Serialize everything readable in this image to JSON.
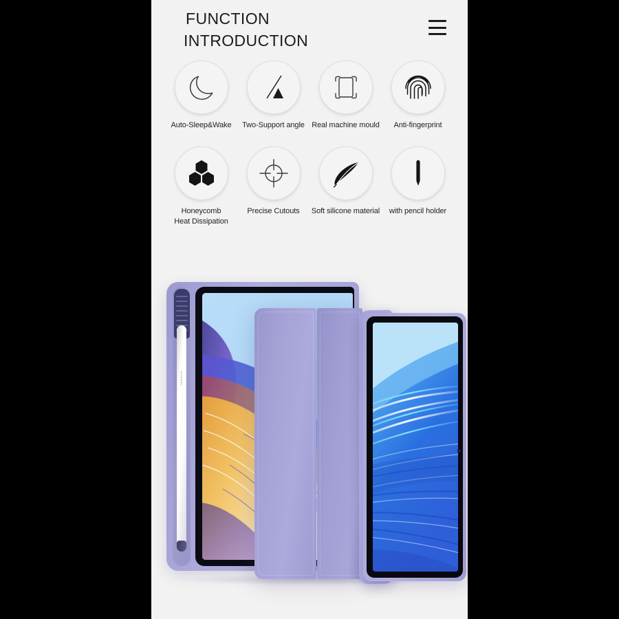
{
  "page": {
    "background_color": "#000000",
    "panel_color": "#f2f2f2"
  },
  "header": {
    "title_line1": "FUNCTION",
    "title_line2": "INTRODUCTION",
    "menu_icon": "hamburger-menu-icon"
  },
  "features": {
    "row1": [
      {
        "icon": "moon-icon",
        "label": "Auto-Sleep&Wake"
      },
      {
        "icon": "stand-angle-icon",
        "label": "Two-Support angle"
      },
      {
        "icon": "device-mould-icon",
        "label": "Real machine mould"
      },
      {
        "icon": "fingerprint-icon",
        "label": "Anti-fingerprint"
      }
    ],
    "row2": [
      {
        "icon": "honeycomb-icon",
        "label_line1": "Honeycomb",
        "label_line2": "Heat Dissipation"
      },
      {
        "icon": "crosshair-icon",
        "label_line1": "Precise Cutouts",
        "label_line2": ""
      },
      {
        "icon": "feather-icon",
        "label_line1": "Soft silicone material",
        "label_line2": ""
      },
      {
        "icon": "pencil-icon",
        "label_line1": "with pencil holder",
        "label_line2": ""
      }
    ]
  },
  "product": {
    "case_color": "#a6a3d6",
    "pencil_brand": "HUAWEI",
    "left_tablet_wallpaper": "abstract-feather-gold-blue",
    "right_tablet_wallpaper": "abstract-blue-waves"
  }
}
